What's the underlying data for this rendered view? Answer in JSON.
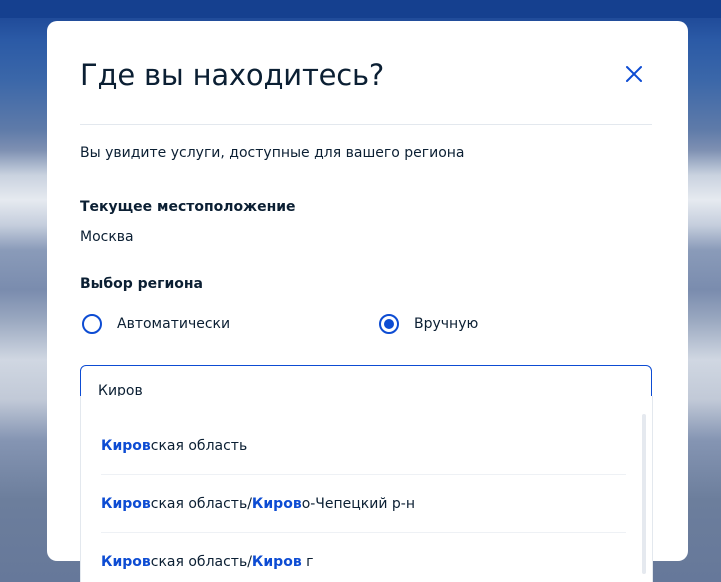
{
  "modal": {
    "title": "Где вы находитесь?",
    "close_icon": "close-icon",
    "subtitle": "Вы увидите услуги, доступные для вашего региона"
  },
  "current_location": {
    "label": "Текущее местоположение",
    "value": "Москва"
  },
  "region_choice": {
    "label": "Выбор региона",
    "options": [
      {
        "label": "Автоматически",
        "checked": false
      },
      {
        "label": "Вручную",
        "checked": true
      }
    ]
  },
  "search": {
    "value": "Киров"
  },
  "suggestions": [
    {
      "parts": [
        {
          "text": "Киров",
          "match": true
        },
        {
          "text": "ская область",
          "match": false
        }
      ]
    },
    {
      "parts": [
        {
          "text": "Киров",
          "match": true
        },
        {
          "text": "ская область/",
          "match": false
        },
        {
          "text": "Киров",
          "match": true
        },
        {
          "text": "о-Чепецкий р-н",
          "match": false
        }
      ]
    },
    {
      "parts": [
        {
          "text": "Киров",
          "match": true
        },
        {
          "text": "ская область/",
          "match": false
        },
        {
          "text": "Киров",
          "match": true
        },
        {
          "text": " г",
          "match": false
        }
      ]
    }
  ],
  "colors": {
    "accent": "#0d4cd3",
    "text": "#0b1f33"
  }
}
